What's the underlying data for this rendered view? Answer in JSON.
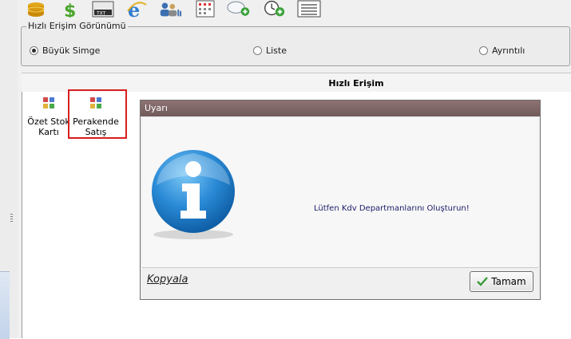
{
  "quick_view": {
    "group_title": "Hızlı Erişim Görünümü",
    "options": [
      {
        "label": "Büyük Simge",
        "selected": true
      },
      {
        "label": "Liste",
        "selected": false
      },
      {
        "label": "Ayrıntılı",
        "selected": false
      }
    ]
  },
  "quick_access": {
    "title": "Hızlı Erişim",
    "items": [
      {
        "line1": "Özet Stok",
        "line2": "Kartı"
      },
      {
        "line1": "Perakende",
        "line2": "Satış"
      }
    ]
  },
  "toolbar": {
    "icons": [
      "database-icon",
      "dollar-icon",
      "txt-export-icon",
      "browser-icon",
      "users-icon",
      "calendar-grid-icon",
      "chat-add-icon",
      "clock-add-icon",
      "list-view-icon"
    ],
    "txt_label": "TXT"
  },
  "dialog": {
    "title": "Uyarı",
    "message": "Lütfen Kdv Departmanlarını Oluşturun!",
    "copy_label": "Kopyala",
    "ok_label": "Tamam"
  },
  "colors": {
    "highlight": "#d81e1e",
    "dialog_title": "#7f6666",
    "info_blue": "#1e78c8"
  }
}
